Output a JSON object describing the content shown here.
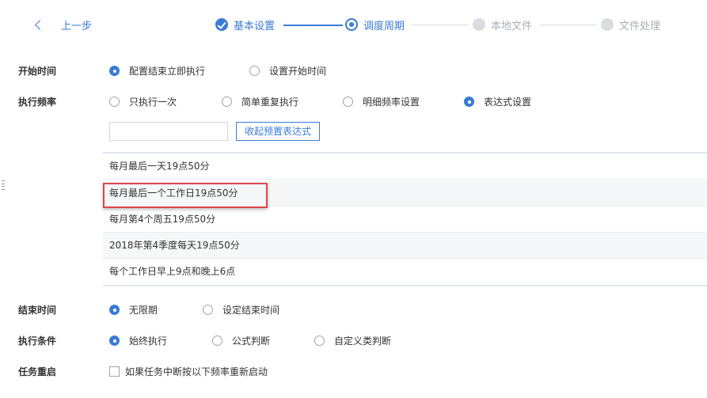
{
  "header": {
    "back_label": "上一步",
    "steps": [
      {
        "label": "基本设置",
        "state": "done"
      },
      {
        "label": "调度周期",
        "state": "current"
      },
      {
        "label": "本地文件",
        "state": "todo"
      },
      {
        "label": "文件处理",
        "state": "todo"
      }
    ]
  },
  "start_time": {
    "label": "开始时间",
    "options": [
      "配置结束立即执行",
      "设置开始时间"
    ],
    "selected": "配置结束立即执行"
  },
  "frequency": {
    "label": "执行频率",
    "options": [
      "只执行一次",
      "简单重复执行",
      "明细频率设置",
      "表达式设置"
    ],
    "selected": "表达式设置",
    "expression_value": "",
    "collapse_button": "收起预置表达式",
    "presets": [
      "每月最后一天19点50分",
      "每月最后一个工作日19点50分",
      "每月第4个周五19点50分",
      "2018年第4季度每天19点50分",
      "每个工作日早上9点和晚上6点"
    ],
    "highlighted_preset": "每月最后一个工作日19点50分"
  },
  "end_time": {
    "label": "结束时间",
    "options": [
      "无限期",
      "设定结束时间"
    ],
    "selected": "无限期"
  },
  "condition": {
    "label": "执行条件",
    "options": [
      "始终执行",
      "公式判断",
      "自定义类判断"
    ],
    "selected": "始终执行"
  },
  "restart": {
    "label": "任务重启",
    "checkbox_label": "如果任务中断按以下频率重新启动",
    "checked": false
  },
  "colors": {
    "accent": "#3a7bd5",
    "inactive": "#d9dce1",
    "highlight_border": "#e0454b"
  }
}
